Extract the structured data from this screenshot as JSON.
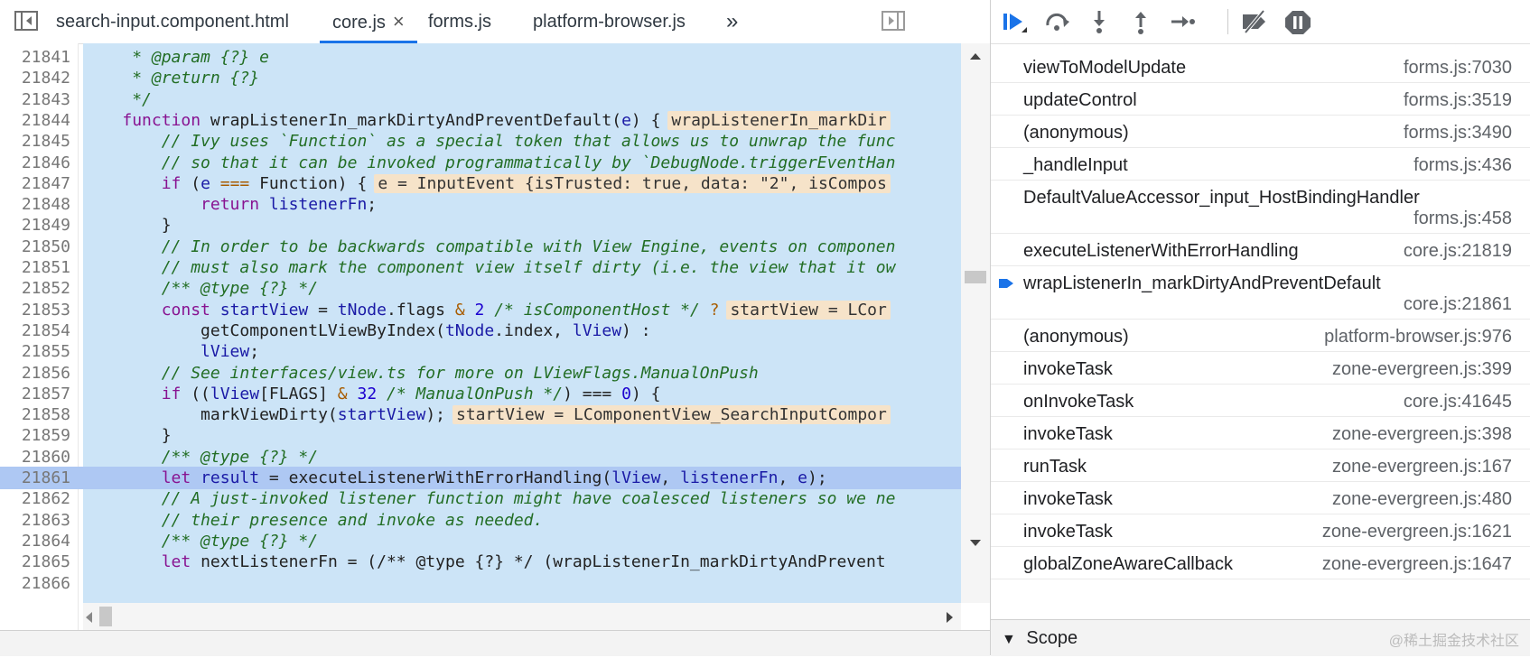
{
  "tabs": [
    {
      "label": "search-input.component.html"
    },
    {
      "label": "core.js",
      "close": "×"
    },
    {
      "label": "forms.js"
    },
    {
      "label": "platform-browser.js"
    }
  ],
  "more_tabs": "»",
  "code": {
    "lines": [
      {
        "n": "21841",
        "segs": [
          {
            "t": "     ",
            "c": ""
          },
          {
            "t": "* @param {?} e",
            "c": "cm"
          }
        ]
      },
      {
        "n": "21842",
        "segs": [
          {
            "t": "     ",
            "c": ""
          },
          {
            "t": "* @return {?}",
            "c": "cm"
          }
        ]
      },
      {
        "n": "21843",
        "segs": [
          {
            "t": "     ",
            "c": ""
          },
          {
            "t": "*/",
            "c": "cm"
          }
        ]
      },
      {
        "n": "21844",
        "segs": [
          {
            "t": "    ",
            "c": ""
          },
          {
            "t": "function ",
            "c": "kw"
          },
          {
            "t": "wrapListenerIn_markDirtyAndPreventDefault(",
            "c": "fn"
          },
          {
            "t": "e",
            "c": "vr"
          },
          {
            "t": ") {",
            "c": ""
          }
        ],
        "inline": "wrapListenerIn_markDir"
      },
      {
        "n": "21845",
        "segs": [
          {
            "t": "        ",
            "c": ""
          },
          {
            "t": "// Ivy uses `Function` as a special token that allows us to unwrap the func",
            "c": "cm"
          }
        ]
      },
      {
        "n": "21846",
        "segs": [
          {
            "t": "        ",
            "c": ""
          },
          {
            "t": "// so that it can be invoked programmatically by `DebugNode.triggerEventHan",
            "c": "cm"
          }
        ]
      },
      {
        "n": "21847",
        "segs": [
          {
            "t": "        ",
            "c": ""
          },
          {
            "t": "if ",
            "c": "kw"
          },
          {
            "t": "(",
            "c": ""
          },
          {
            "t": "e",
            "c": "vr"
          },
          {
            "t": " === ",
            "c": "op"
          },
          {
            "t": "Function) {",
            "c": ""
          }
        ],
        "inline": "e = InputEvent {isTrusted: true, data: \"2\", isCompos"
      },
      {
        "n": "21848",
        "segs": [
          {
            "t": "            ",
            "c": ""
          },
          {
            "t": "return ",
            "c": "kw"
          },
          {
            "t": "listenerFn",
            "c": "vr"
          },
          {
            "t": ";",
            "c": ""
          }
        ]
      },
      {
        "n": "21849",
        "segs": [
          {
            "t": "        }",
            "c": ""
          }
        ]
      },
      {
        "n": "21850",
        "segs": [
          {
            "t": "        ",
            "c": ""
          },
          {
            "t": "// In order to be backwards compatible with View Engine, events on componen",
            "c": "cm"
          }
        ]
      },
      {
        "n": "21851",
        "segs": [
          {
            "t": "        ",
            "c": ""
          },
          {
            "t": "// must also mark the component view itself dirty (i.e. the view that it ow",
            "c": "cm"
          }
        ]
      },
      {
        "n": "21852",
        "segs": [
          {
            "t": "        ",
            "c": ""
          },
          {
            "t": "/** @type {?} */",
            "c": "cm"
          }
        ]
      },
      {
        "n": "21853",
        "segs": [
          {
            "t": "        ",
            "c": ""
          },
          {
            "t": "const ",
            "c": "kw"
          },
          {
            "t": "startView",
            "c": "vr"
          },
          {
            "t": " = ",
            "c": ""
          },
          {
            "t": "tNode",
            "c": "vr"
          },
          {
            "t": ".flags ",
            "c": ""
          },
          {
            "t": "& ",
            "c": "op"
          },
          {
            "t": "2",
            "c": "nm"
          },
          {
            "t": " /* isComponentHost */ ",
            "c": "cm"
          },
          {
            "t": "?",
            "c": "op"
          }
        ],
        "inline": "startView = LCor"
      },
      {
        "n": "21854",
        "segs": [
          {
            "t": "            getComponentLViewByIndex(",
            "c": ""
          },
          {
            "t": "tNode",
            "c": "vr"
          },
          {
            "t": ".index, ",
            "c": ""
          },
          {
            "t": "lView",
            "c": "vr"
          },
          {
            "t": ") :",
            "c": ""
          }
        ]
      },
      {
        "n": "21855",
        "segs": [
          {
            "t": "            ",
            "c": ""
          },
          {
            "t": "lView",
            "c": "vr"
          },
          {
            "t": ";",
            "c": ""
          }
        ]
      },
      {
        "n": "21856",
        "segs": [
          {
            "t": "        ",
            "c": ""
          },
          {
            "t": "// See interfaces/view.ts for more on LViewFlags.ManualOnPush",
            "c": "cm"
          }
        ]
      },
      {
        "n": "21857",
        "segs": [
          {
            "t": "        ",
            "c": ""
          },
          {
            "t": "if ",
            "c": "kw"
          },
          {
            "t": "((",
            "c": ""
          },
          {
            "t": "lView",
            "c": "vr"
          },
          {
            "t": "[FLAGS] ",
            "c": ""
          },
          {
            "t": "& ",
            "c": "op"
          },
          {
            "t": "32",
            "c": "nm"
          },
          {
            "t": " /* ManualOnPush */",
            "c": "cm"
          },
          {
            "t": ") === ",
            "c": ""
          },
          {
            "t": "0",
            "c": "nm"
          },
          {
            "t": ") {",
            "c": ""
          }
        ]
      },
      {
        "n": "21858",
        "segs": [
          {
            "t": "            markViewDirty(",
            "c": ""
          },
          {
            "t": "startView",
            "c": "vr"
          },
          {
            "t": ");",
            "c": ""
          }
        ],
        "inline": "startView = LComponentView_SearchInputCompor"
      },
      {
        "n": "21859",
        "segs": [
          {
            "t": "        }",
            "c": ""
          }
        ]
      },
      {
        "n": "21860",
        "segs": [
          {
            "t": "        ",
            "c": ""
          },
          {
            "t": "/** @type {?} */",
            "c": "cm"
          }
        ]
      },
      {
        "n": "21861",
        "segs": [
          {
            "t": "        ",
            "c": ""
          },
          {
            "t": "let ",
            "c": "kw"
          },
          {
            "t": "result",
            "c": "vr"
          },
          {
            "t": " = executeListenerWithErrorHandling(",
            "c": ""
          },
          {
            "t": "lView",
            "c": "vr"
          },
          {
            "t": ", ",
            "c": ""
          },
          {
            "t": "listenerFn",
            "c": "vr"
          },
          {
            "t": ", ",
            "c": ""
          },
          {
            "t": "e",
            "c": "vr"
          },
          {
            "t": ");",
            "c": ""
          }
        ],
        "exec": true
      },
      {
        "n": "21862",
        "segs": [
          {
            "t": "        ",
            "c": ""
          },
          {
            "t": "// A just-invoked listener function might have coalesced listeners so we ne",
            "c": "cm"
          }
        ]
      },
      {
        "n": "21863",
        "segs": [
          {
            "t": "        ",
            "c": ""
          },
          {
            "t": "// their presence and invoke as needed.",
            "c": "cm"
          }
        ]
      },
      {
        "n": "21864",
        "segs": [
          {
            "t": "        ",
            "c": ""
          },
          {
            "t": "/** @type {?} */",
            "c": "cm"
          }
        ]
      },
      {
        "n": "21865",
        "segs": [
          {
            "t": "        ",
            "c": ""
          },
          {
            "t": "let ",
            "c": "kw"
          },
          {
            "t": "nextListenerFn = (/** @type {?} */ (wrapListenerIn_markDirtyAndPrevent",
            "c": ""
          }
        ]
      },
      {
        "n": "21866",
        "segs": []
      }
    ]
  },
  "call_stack": [
    {
      "name": "viewToModelUpdate",
      "loc": "forms.js:7030"
    },
    {
      "name": "updateControl",
      "loc": "forms.js:3519"
    },
    {
      "name": "(anonymous)",
      "loc": "forms.js:3490"
    },
    {
      "name": "_handleInput",
      "loc": "forms.js:436"
    },
    {
      "name": "DefaultValueAccessor_input_HostBindingHandler",
      "loc": "forms.js:458",
      "wrap": true
    },
    {
      "name": "executeListenerWithErrorHandling",
      "loc": "core.js:21819"
    },
    {
      "name": "wrapListenerIn_markDirtyAndPreventDefault",
      "loc": "core.js:21861",
      "wrap": true,
      "current": true
    },
    {
      "name": "(anonymous)",
      "loc": "platform-browser.js:976"
    },
    {
      "name": "invokeTask",
      "loc": "zone-evergreen.js:399"
    },
    {
      "name": "onInvokeTask",
      "loc": "core.js:41645"
    },
    {
      "name": "invokeTask",
      "loc": "zone-evergreen.js:398"
    },
    {
      "name": "runTask",
      "loc": "zone-evergreen.js:167"
    },
    {
      "name": "invokeTask",
      "loc": "zone-evergreen.js:480"
    },
    {
      "name": "invokeTask",
      "loc": "zone-evergreen.js:1621"
    },
    {
      "name": "globalZoneAwareCallback",
      "loc": "zone-evergreen.js:1647"
    }
  ],
  "scope": {
    "arrow": "▼",
    "label": "Scope"
  },
  "watermark": "@稀土掘金技术社区",
  "colors": {
    "accent": "#1a73e8",
    "current_frame": "#1a73e8",
    "exec_line": "#aec8f3",
    "selection_bg": "#cce4f7"
  }
}
